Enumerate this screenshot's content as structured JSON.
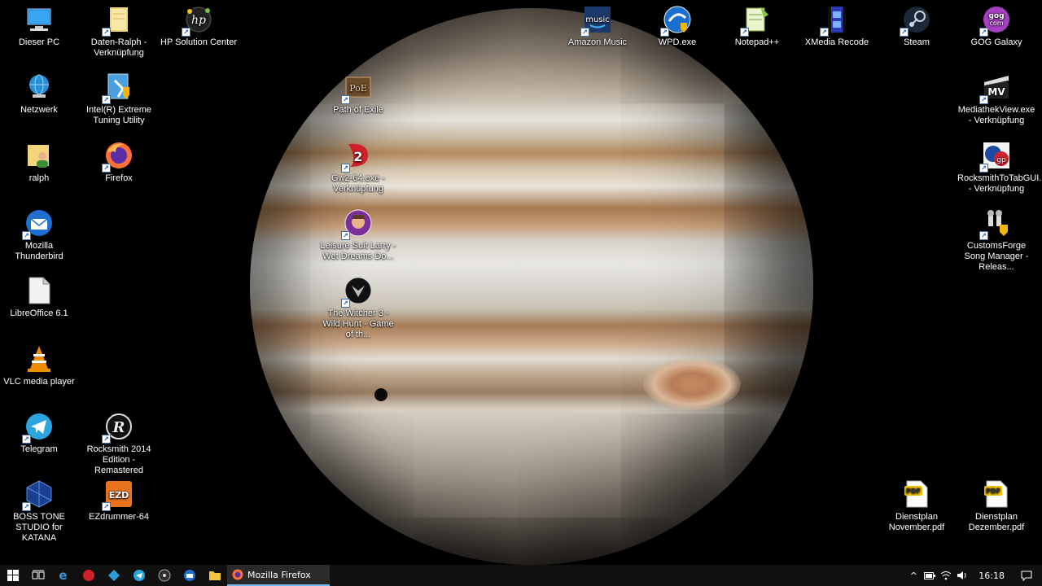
{
  "desktop": {
    "icons": [
      {
        "label": "Dieser PC",
        "icon": "pc-icon"
      },
      {
        "label": "Daten-Ralph - Verknüpfung",
        "icon": "folder-icon"
      },
      {
        "label": "HP Solution Center",
        "icon": "hp-icon"
      },
      {
        "label": "Netzwerk",
        "icon": "network-icon"
      },
      {
        "label": "Intel(R) Extreme Tuning Utility",
        "icon": "intel-xtu-icon"
      },
      {
        "label": "ralph",
        "icon": "user-folder-icon"
      },
      {
        "label": "Firefox",
        "icon": "firefox-icon"
      },
      {
        "label": "Mozilla Thunderbird",
        "icon": "thunderbird-icon"
      },
      {
        "label": "LibreOffice 6.1",
        "icon": "libreoffice-icon"
      },
      {
        "label": "VLC media player",
        "icon": "vlc-icon"
      },
      {
        "label": "Telegram",
        "icon": "telegram-icon"
      },
      {
        "label": "Rocksmith 2014 Edition - Remastered",
        "icon": "rocksmith-icon"
      },
      {
        "label": "BOSS TONE STUDIO for KATANA",
        "icon": "boss-icon"
      },
      {
        "label": "EZdrummer-64",
        "icon": "ezdrummer-icon"
      },
      {
        "label": "Path of Exile",
        "icon": "poe-icon"
      },
      {
        "label": "Gw2-64.exe - Verknüpfung",
        "icon": "gw2-icon"
      },
      {
        "label": "Leisure Suit Larry - Wet Dreams Do...",
        "icon": "larry-icon"
      },
      {
        "label": "The Witcher 3 - Wild Hunt - Game of th...",
        "icon": "witcher-icon"
      },
      {
        "label": "Amazon Music",
        "icon": "amazon-music-icon"
      },
      {
        "label": "WPD.exe",
        "icon": "wpd-icon"
      },
      {
        "label": "Notepad++",
        "icon": "notepadpp-icon"
      },
      {
        "label": "XMedia Recode",
        "icon": "xmedia-icon"
      },
      {
        "label": "Steam",
        "icon": "steam-icon"
      },
      {
        "label": "GOG Galaxy",
        "icon": "gog-icon"
      },
      {
        "label": "MediathekView.exe - Verknüpfung",
        "icon": "mediathekview-icon"
      },
      {
        "label": "RocksmithToTabGUI... - Verknüpfung",
        "icon": "rstotab-icon"
      },
      {
        "label": "CustomsForge Song Manager - Releas...",
        "icon": "customsforge-icon"
      },
      {
        "label": "Dienstplan November.pdf",
        "icon": "pdf-icon"
      },
      {
        "label": "Dienstplan Dezember.pdf",
        "icon": "pdf-icon"
      }
    ],
    "icon_texts": {
      "amazon_music": "music",
      "poe": "PoE",
      "ezd": "EZD",
      "gog": "gog com",
      "mv": "MV",
      "rs": "gp",
      "pdf": "PDF",
      "gw2": "2"
    }
  },
  "taskbar": {
    "active_app": "Mozilla Firefox",
    "clock": "16:18"
  },
  "colors": {
    "taskbar_bg": "#101010",
    "active_underline": "#76b9ed"
  }
}
